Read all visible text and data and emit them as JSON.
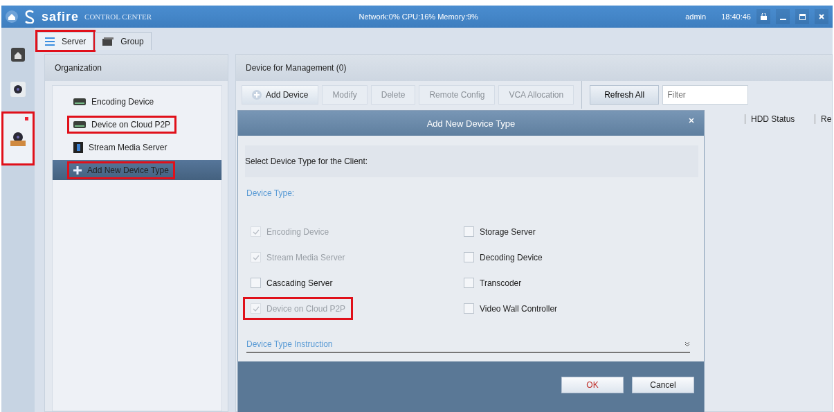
{
  "title_bar": {
    "logo": "safire",
    "subtitle": "CONTROL CENTER",
    "status": "Network:0% CPU:16% Memory:9%",
    "user": "admin",
    "time": "18:40:46"
  },
  "rail": [
    {
      "kind": "home",
      "selected": false,
      "highlighted": false,
      "badge": false
    },
    {
      "kind": "camera",
      "selected": false,
      "highlighted": false,
      "badge": false
    },
    {
      "kind": "device",
      "selected": true,
      "highlighted": true,
      "badge": true
    }
  ],
  "tabs": [
    {
      "label": "Server",
      "kind": "server",
      "selected": true,
      "highlighted": true
    },
    {
      "label": "Group",
      "kind": "group",
      "selected": false,
      "highlighted": false
    }
  ],
  "organization": {
    "title": "Organization",
    "items": [
      {
        "label": "Encoding Device",
        "kind": "device",
        "selected": false,
        "highlighted": false
      },
      {
        "label": "Device on Cloud P2P",
        "kind": "device",
        "selected": false,
        "highlighted": true
      },
      {
        "label": "Stream Media Server",
        "kind": "server",
        "selected": false,
        "highlighted": false
      },
      {
        "label": "Add New Device Type",
        "kind": "add",
        "selected": true,
        "highlighted": true
      }
    ]
  },
  "management": {
    "title": "Device for Management (0)",
    "toolbar": [
      {
        "label": "Add Device",
        "kind": "add",
        "disabled": false
      },
      {
        "label": "Modify",
        "kind": "plain",
        "disabled": true
      },
      {
        "label": "Delete",
        "kind": "plain",
        "disabled": true
      },
      {
        "label": "Remote Config",
        "kind": "plain",
        "disabled": true
      },
      {
        "label": "VCA Allocation",
        "kind": "plain",
        "disabled": true
      }
    ],
    "refresh": "Refresh All",
    "filter": {
      "placeholder": "Filter"
    },
    "columns": [
      "HDD Status",
      "Re"
    ]
  },
  "dialog": {
    "title": "Add New Device Type",
    "prompt": "Select Device Type for the Client:",
    "section": "Device Type:",
    "options": [
      {
        "label": "Encoding Device",
        "checked": true,
        "disabled": true,
        "highlighted": false
      },
      {
        "label": "Stream Media Server",
        "checked": true,
        "disabled": true,
        "highlighted": false
      },
      {
        "label": "Cascading Server",
        "checked": false,
        "disabled": false,
        "highlighted": false
      },
      {
        "label": "Device on Cloud P2P",
        "checked": true,
        "disabled": true,
        "highlighted": true
      },
      {
        "label": "Storage Server",
        "checked": false,
        "disabled": false,
        "highlighted": false
      },
      {
        "label": "Decoding Device",
        "checked": false,
        "disabled": false,
        "highlighted": false
      },
      {
        "label": "Transcoder",
        "checked": false,
        "disabled": false,
        "highlighted": false
      },
      {
        "label": "Video Wall Controller",
        "checked": false,
        "disabled": false,
        "highlighted": false
      }
    ],
    "instruction": "Device Type Instruction",
    "ok": "OK",
    "cancel": "Cancel"
  }
}
